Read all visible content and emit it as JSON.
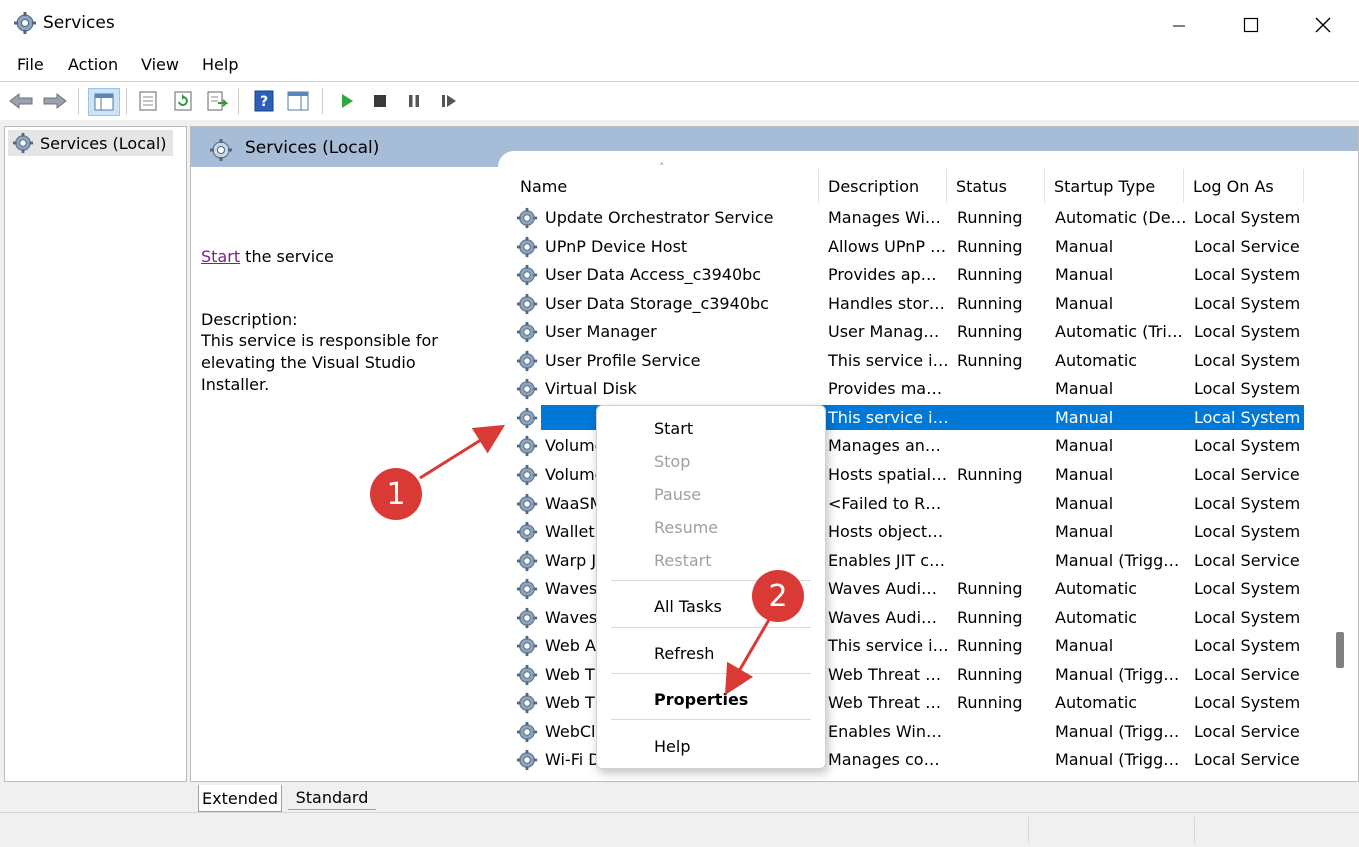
{
  "window": {
    "title": "Services"
  },
  "menu": [
    "File",
    "Action",
    "View",
    "Help"
  ],
  "tree": {
    "root_label": "Services (Local)"
  },
  "pane": {
    "header_title": "Services (Local)",
    "start_link": "Start",
    "start_suffix": " the service",
    "description_label": "Description:",
    "description_text": "This service is responsible for elevating the Visual Studio Installer."
  },
  "columns": [
    "Name",
    "Description",
    "Status",
    "Startup Type",
    "Log On As"
  ],
  "rows": [
    {
      "name": "Update Orchestrator Service",
      "description": "Manages Wi…",
      "status": "Running",
      "startup": "Automatic (De…",
      "logon": "Local System"
    },
    {
      "name": "UPnP Device Host",
      "description": "Allows UPnP …",
      "status": "Running",
      "startup": "Manual",
      "logon": "Local Service"
    },
    {
      "name": "User Data Access_c3940bc",
      "description": "Provides ap…",
      "status": "Running",
      "startup": "Manual",
      "logon": "Local System"
    },
    {
      "name": "User Data Storage_c3940bc",
      "description": "Handles stor…",
      "status": "Running",
      "startup": "Manual",
      "logon": "Local System"
    },
    {
      "name": "User Manager",
      "description": "User Manag…",
      "status": "Running",
      "startup": "Automatic (Tri…",
      "logon": "Local System"
    },
    {
      "name": "User Profile Service",
      "description": "This service i…",
      "status": "Running",
      "startup": "Automatic",
      "logon": "Local System"
    },
    {
      "name": "Virtual Disk",
      "description": "Provides ma…",
      "status": "",
      "startup": "Manual",
      "logon": "Local System"
    },
    {
      "name": "",
      "description": "This service i…",
      "status": "",
      "startup": "Manual",
      "logon": "Local System",
      "selected": true
    },
    {
      "name": "Volume",
      "description": "Manages an…",
      "status": "",
      "startup": "Manual",
      "logon": "Local System"
    },
    {
      "name": "Volume",
      "description": "Hosts spatial…",
      "status": "Running",
      "startup": "Manual",
      "logon": "Local Service"
    },
    {
      "name": "WaaSM",
      "description": "<Failed to R…",
      "status": "",
      "startup": "Manual",
      "logon": "Local System"
    },
    {
      "name": "Wallet",
      "description": "Hosts object…",
      "status": "",
      "startup": "Manual",
      "logon": "Local System"
    },
    {
      "name": "Warp J",
      "description": "Enables JIT c…",
      "status": "",
      "startup": "Manual (Trigg…",
      "logon": "Local Service"
    },
    {
      "name": "Waves",
      "description": "Waves Audi…",
      "status": "Running",
      "startup": "Automatic",
      "logon": "Local System"
    },
    {
      "name": "Waves",
      "description": "Waves Audi…",
      "status": "Running",
      "startup": "Automatic",
      "logon": "Local System"
    },
    {
      "name": "Web A",
      "description": "This service i…",
      "status": "Running",
      "startup": "Manual",
      "logon": "Local System"
    },
    {
      "name": "Web Th",
      "description": "Web Threat …",
      "status": "Running",
      "startup": "Manual (Trigg…",
      "logon": "Local Service"
    },
    {
      "name": "Web Th",
      "description": "Web Threat …",
      "status": "Running",
      "startup": "Automatic",
      "logon": "Local System"
    },
    {
      "name": "WebCl",
      "description": "Enables Win…",
      "status": "",
      "startup": "Manual (Trigg…",
      "logon": "Local Service"
    },
    {
      "name": "Wi-Fi D",
      "description": "Manages co…",
      "status": "",
      "startup": "Manual (Trigg…",
      "logon": "Local Service"
    }
  ],
  "context_menu": {
    "start": "Start",
    "stop": "Stop",
    "pause": "Pause",
    "resume": "Resume",
    "restart": "Restart",
    "all_tasks": "All Tasks",
    "refresh": "Refresh",
    "properties": "Properties",
    "help": "Help"
  },
  "tabs": {
    "extended": "Extended",
    "standard": "Standard"
  },
  "annotations": {
    "one": "1",
    "two": "2"
  },
  "colors": {
    "accent": "#0078d7",
    "annotation": "#d93a36",
    "pane_header": "#a7bcd6",
    "link": "#7a1f8f"
  },
  "icons": [
    "gear-icon",
    "back-arrow-icon",
    "forward-arrow-icon",
    "play-icon",
    "stop-icon",
    "pause-icon",
    "resume-icon",
    "help-icon"
  ]
}
